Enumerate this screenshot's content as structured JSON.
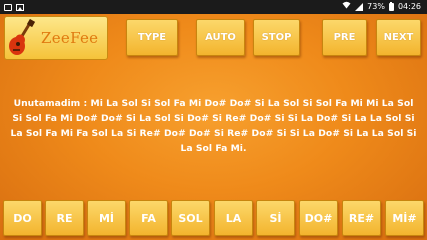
{
  "status_bar": {
    "battery": "73%",
    "time": "04:26",
    "icons": [
      "notification-square-icon",
      "photo-icon",
      "wifi-icon",
      "signal-icon",
      "battery-icon"
    ]
  },
  "app": {
    "logo_text": "ZeeFee",
    "logo_icon": "guitar-icon"
  },
  "toolbar": {
    "type_label": "TYPE",
    "auto_label": "AUTO",
    "stop_label": "STOP",
    "pre_label": "PRE",
    "next_label": "NEXT"
  },
  "song": {
    "lyrics": "Unutamadim : Mi La Sol Si Sol Fa Mi Do# Do# Si La Sol Si Sol Fa Mi Mi La Sol Si Sol Fa Mi Do# Do# Si La Sol Si Do# Si Re# Do# Si Si La Do# Si La La Sol Si La Sol Fa Mi Fa Sol La Si Re# Do# Do# Si Re# Do# Si Si La Do# Si La La Sol Si La Sol Fa Mi."
  },
  "notes": [
    {
      "label": "DO"
    },
    {
      "label": "RE"
    },
    {
      "label": "Mİ"
    },
    {
      "label": "FA"
    },
    {
      "label": "SOL"
    },
    {
      "label": "LA"
    },
    {
      "label": "Sİ"
    },
    {
      "label": "DO#"
    },
    {
      "label": "RE#"
    },
    {
      "label": "Mİ#"
    }
  ]
}
